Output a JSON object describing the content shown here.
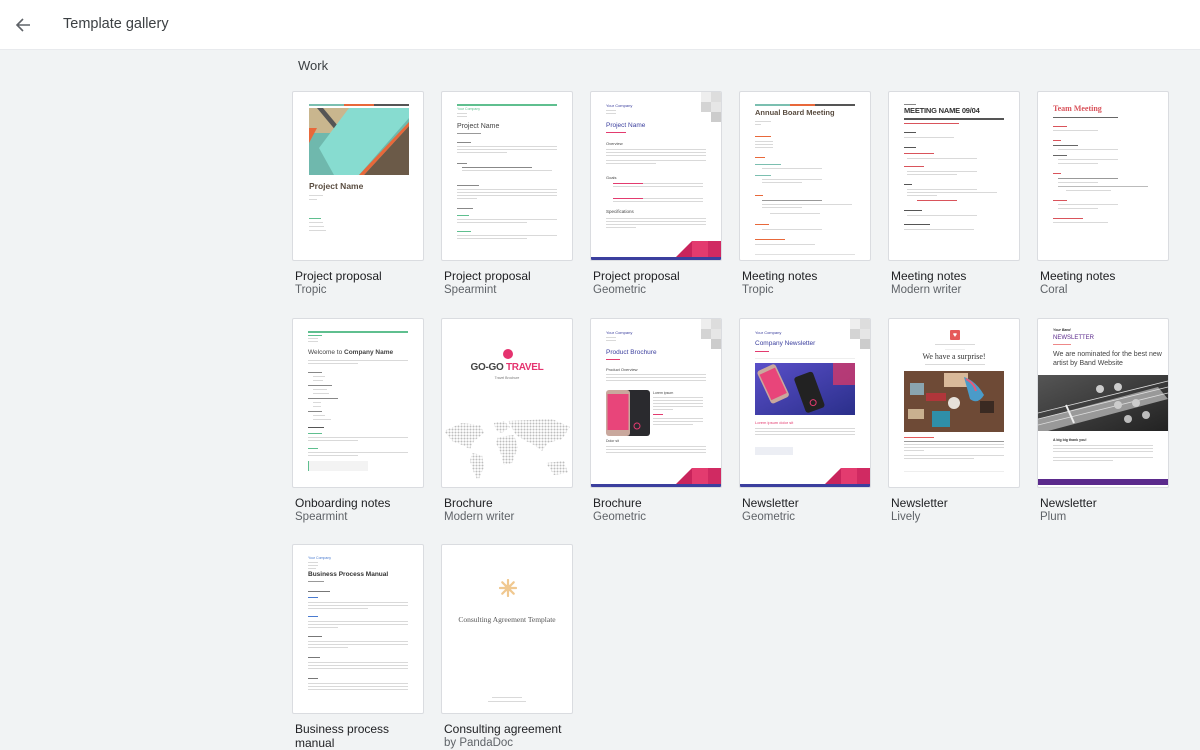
{
  "header": {
    "title": "Template gallery",
    "back_icon": "arrow-left-icon"
  },
  "section": {
    "title": "Work"
  },
  "templates": [
    {
      "title": "Project proposal",
      "subtitle": "Tropic",
      "preview": {
        "heading": "Project Name"
      }
    },
    {
      "title": "Project proposal",
      "subtitle": "Spearmint",
      "preview": {
        "heading": "Project Name",
        "company": "Your Company"
      }
    },
    {
      "title": "Project proposal",
      "subtitle": "Geometric",
      "preview": {
        "heading": "Project Name",
        "company": "Your Company",
        "sections": [
          "Overview",
          "Goals",
          "Specifications"
        ]
      }
    },
    {
      "title": "Meeting notes",
      "subtitle": "Tropic",
      "preview": {
        "heading": "Annual Board Meeting"
      }
    },
    {
      "title": "Meeting notes",
      "subtitle": "Modern writer",
      "preview": {
        "heading": "MEETING NAME 09/04"
      }
    },
    {
      "title": "Meeting notes",
      "subtitle": "Coral",
      "preview": {
        "heading": "Team Meeting"
      }
    },
    {
      "title": "Onboarding notes",
      "subtitle": "Spearmint",
      "preview": {
        "heading_prefix": "Welcome to ",
        "heading_bold": "Company Name"
      }
    },
    {
      "title": "Brochure",
      "subtitle": "Modern writer",
      "preview": {
        "heading_a": "GO-GO ",
        "heading_b": "TRAVEL",
        "tagline": "Travel Brochure"
      }
    },
    {
      "title": "Brochure",
      "subtitle": "Geometric",
      "preview": {
        "heading": "Product Brochure",
        "company": "Your Company",
        "sections": [
          "Product Overview",
          "Lorem ipsum",
          "Dolor sit"
        ]
      }
    },
    {
      "title": "Newsletter",
      "subtitle": "Geometric",
      "preview": {
        "heading": "Company Newsletter",
        "company": "Your Company",
        "subheading": "Lorem ipsum dolor sit"
      }
    },
    {
      "title": "Newsletter",
      "subtitle": "Lively",
      "preview": {
        "heading": "We have a surprise!"
      }
    },
    {
      "title": "Newsletter",
      "subtitle": "Plum",
      "preview": {
        "band": "Your Band",
        "label": "NEWSLETTER",
        "heading": "We are nominated for the best new artist by Band Website",
        "subheading": "A big big thank you!"
      }
    },
    {
      "title": "Business process manual",
      "subtitle": "",
      "preview": {
        "heading": "Business Process Manual",
        "company": "Your Company"
      }
    },
    {
      "title": "Consulting agreement",
      "subtitle": "by PandaDoc",
      "preview": {
        "heading": "Consulting Agreement Template"
      }
    }
  ],
  "colors": {
    "page_bg": "#f1f3f4",
    "header_bg": "#ffffff",
    "card_border": "#dadce0",
    "title_text": "#202124",
    "subtitle_text": "#5f6368",
    "tropic_teal": "#80d8cc",
    "tropic_orange": "#e8683a",
    "spearmint_green": "#5fbf8f",
    "geometric_navy": "#3b3f9e",
    "geometric_pink": "#e33b6f",
    "coral_red": "#d9535b",
    "plum_purple": "#5b2a8c",
    "travel_pink": "#e5336f"
  }
}
